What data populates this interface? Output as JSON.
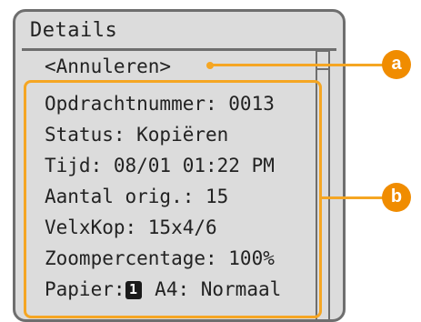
{
  "screen": {
    "title": "Details",
    "cancel_label": "<Annuleren>",
    "details": [
      {
        "label": "Opdrachtnummer: 0013"
      },
      {
        "label": "Status: Kopiëren"
      },
      {
        "label": "Tijd: 08/01 01:22 PM"
      },
      {
        "label": "Aantal orig.: 15"
      },
      {
        "label": "VelxKop: 15x4/6"
      },
      {
        "label": "Zoompercentage: 100%"
      }
    ],
    "paper": {
      "label": "Papier:",
      "badge": "1",
      "value": "A4: Normaal"
    }
  },
  "callouts": {
    "a": "a",
    "b": "b"
  },
  "colors": {
    "highlight": "#f5a623",
    "callout": "#f08c00",
    "screen_bg": "#dcdcdc",
    "frame": "#6e6e6e"
  }
}
